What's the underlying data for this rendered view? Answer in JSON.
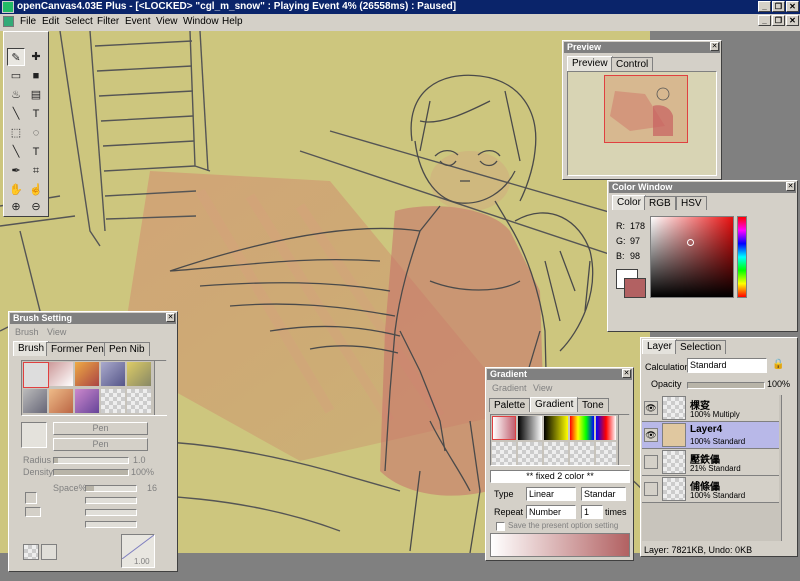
{
  "window": {
    "title": "openCanvas4.03E Plus - [<LOCKED> \"cgl_m_snow\" : Playing Event 4% (26558ms) : Paused]",
    "minimize_glyph": "_",
    "restore_glyph": "❐",
    "close_glyph": "✕"
  },
  "menu": [
    "File",
    "Edit",
    "Select",
    "Filter",
    "Event",
    "View",
    "Window",
    "Help"
  ],
  "tools": [
    {
      "icon": "pen-icon",
      "glyph": "✎"
    },
    {
      "icon": "move-icon",
      "glyph": "✚"
    },
    {
      "icon": "rect-select-icon",
      "glyph": "▭"
    },
    {
      "icon": "fill-rect-icon",
      "glyph": "■"
    },
    {
      "icon": "bucket-icon",
      "glyph": "♨"
    },
    {
      "icon": "gradient-icon",
      "glyph": "▤"
    },
    {
      "icon": "line-icon",
      "glyph": "╲"
    },
    {
      "icon": "text-icon",
      "glyph": "T"
    },
    {
      "icon": "marquee-rect-icon",
      "glyph": "⬚"
    },
    {
      "icon": "lasso-icon",
      "glyph": "◌"
    },
    {
      "icon": "line-select-icon",
      "glyph": "╲"
    },
    {
      "icon": "text-select-icon",
      "glyph": "T"
    },
    {
      "icon": "eyedropper-icon",
      "glyph": "✒"
    },
    {
      "icon": "crop-icon",
      "glyph": "⌗"
    },
    {
      "icon": "hand-icon",
      "glyph": "✋"
    },
    {
      "icon": "rotate-hand-icon",
      "glyph": "☝"
    },
    {
      "icon": "zoom-in-icon",
      "glyph": "⊕"
    },
    {
      "icon": "zoom-out-icon",
      "glyph": "⊖"
    }
  ],
  "preview": {
    "title": "Preview",
    "tabs": [
      "Preview",
      "Control"
    ]
  },
  "color_window": {
    "title": "Color Window",
    "tabs": [
      "Color",
      "RGB",
      "HSV"
    ],
    "r_label": "R:",
    "r": "178",
    "g_label": "G:",
    "g": "97",
    "b_label": "B:",
    "b": "98",
    "fg_color": "#b26162",
    "bg_color": "#ffffff"
  },
  "layers": {
    "tabs": [
      "Layer",
      "Selection"
    ],
    "calc_label": "Calculation",
    "calc_value": "Standard",
    "opacity_label": "Opacity",
    "opacity_value": "100%",
    "opacity": 1.0,
    "items": [
      {
        "name": "棵叜",
        "mode": "100% Multiply",
        "visible": true,
        "active": false
      },
      {
        "name": "Layer4",
        "mode": "100% Standard",
        "visible": true,
        "active": true
      },
      {
        "name": "壓鉄儡",
        "mode": "21% Standard",
        "visible": false,
        "active": false
      },
      {
        "name": "俌條儡",
        "mode": "100% Standard",
        "visible": false,
        "active": false
      }
    ],
    "status": "Layer: 7821KB, Undo: 0KB",
    "visible_glyph": "👁"
  },
  "brush": {
    "title": "Brush Setting",
    "menu": [
      "Brush",
      "View"
    ],
    "tabs": [
      "Brush",
      "Former Pen",
      "Pen Nib"
    ],
    "pen_label_1": "Pen",
    "pen_label_2": "Pen",
    "radius_label": "Radius",
    "radius_value": "1.0",
    "radius": 0.05,
    "density_label": "Density",
    "density_value": "100%",
    "density": 1.0,
    "space_label": "Space%",
    "space_value": "16",
    "space": 0.16,
    "curve_value": "1.00"
  },
  "gradient": {
    "title": "Gradient",
    "menu": [
      "Gradient",
      "View"
    ],
    "tabs": [
      "Palette",
      "Gradient",
      "Tone"
    ],
    "preset_name": "** fixed 2 color **",
    "type_label": "Type",
    "type_value": "Linear",
    "type2_value": "Standar",
    "repeat_label": "Repeat",
    "repeat_value": "Number",
    "times_value": "1",
    "times_label": "times",
    "save_label": "Save the present option setting"
  }
}
